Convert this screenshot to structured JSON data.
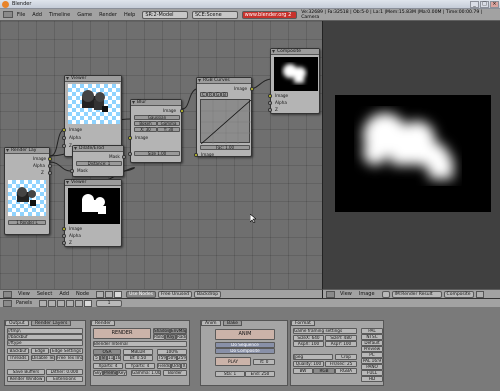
{
  "window": {
    "title": "Blender",
    "controls": [
      "_",
      "□",
      "×"
    ]
  },
  "info_header": {
    "menus": [
      "File",
      "Add",
      "Timeline",
      "Game",
      "Render",
      "Help"
    ],
    "screen": "SR:2-Model",
    "scene": "SCE:Scene",
    "url": "www.blender.org 2",
    "stats": "Ve:32689 | Fa:32518 | Ob:5-0 | La:1   |Mem:15.83M   |Ma:0.00M | Time:00:00.79 | Camera"
  },
  "nodes": {
    "viewer1": {
      "title": "Viewer",
      "inputs": [
        "Image",
        "Alpha",
        "Z"
      ]
    },
    "render_layers": {
      "title": "Render Lay",
      "outputs": [
        "Image",
        "Alpha",
        "Z"
      ],
      "layer": "1 Render L"
    },
    "blur": {
      "title": "Blur",
      "output": "Image",
      "type": "Gaussian",
      "bokeh": "Bokeh",
      "gamma": "Gamma",
      "x": "X: 30",
      "y": "Y: 30",
      "input": "Image",
      "size": "Size 1.00"
    },
    "dilate": {
      "title": "Dilate/Erod",
      "output": "Mask",
      "distance": "Distance: 1",
      "input": "Mask"
    },
    "viewer2": {
      "title": "Viewer",
      "inputs": [
        "Image",
        "Alpha",
        "Z"
      ]
    },
    "rgb_curves": {
      "title": "RGB Curves",
      "output": "Image",
      "channels": [
        "C",
        "R",
        "G",
        "B"
      ],
      "fac": "Fac: 1.00",
      "input": "Image"
    },
    "composite": {
      "title": "Composite",
      "inputs": [
        "Image",
        "Alpha",
        "Z"
      ]
    }
  },
  "node_header": {
    "menus": [
      "View",
      "Select",
      "Add",
      "Node"
    ],
    "buttons": [
      "Use Nodes",
      "Free Unused",
      "Backdrop"
    ]
  },
  "image_header": {
    "menus": [
      "View",
      "Image"
    ],
    "image_name": "IM:Render Result",
    "composite": "Composite"
  },
  "buttons_header": {
    "label": "Panels",
    "frame": "1"
  },
  "panels": {
    "output": {
      "tabs": [
        "Output",
        "Render Layers"
      ],
      "paths": [
        "//tmp\\",
        "//backbuf",
        "//ftype"
      ],
      "rows": [
        "Backbuf",
        "Edge",
        "Edge Settings",
        "Threads",
        "Disable Tex",
        "Free Tex Images",
        "Save Buffers",
        "Dither: 0.000",
        "Render Window",
        "Extensions"
      ]
    },
    "render": {
      "tab": "Render",
      "render_button": "RENDER",
      "shadow": "Shadow",
      "envmap": "EnvMap",
      "pano": "Pano",
      "ray": "Ray",
      "radio": "Radio",
      "engine": "Blender Internal",
      "osa": "OSA",
      "mblur": "MBLUR",
      "osa_levels": [
        "5",
        "8",
        "11",
        "16"
      ],
      "bf": "Bf: 0.50",
      "percent": [
        "100%",
        "75%",
        "50%",
        "25%"
      ],
      "xparts": "Xparts: 4",
      "yparts": "Yparts: 4",
      "fields": "Fields",
      "odd": "Odd",
      "x": "X",
      "sky": "Sky",
      "premul": "Premul",
      "key": "Key",
      "gamma": "Gamma: 1.00",
      "border": "Border"
    },
    "anim": {
      "tabs": [
        "Anim",
        "Bake"
      ],
      "anim_button": "ANIM",
      "do_sequence": "Do Sequence",
      "do_composite": "Do Composite",
      "play": "PLAY",
      "rt": "rt: 0",
      "sta": "Sta: 1",
      "end": "End: 250"
    },
    "format": {
      "tab": "Format",
      "preset": "Game framing settings",
      "sizex": "SizeX: 640",
      "sizey": "SizeY: 480",
      "aspx": "AspX: 100",
      "aspy": "AspY: 100",
      "format": "Jpeg",
      "crop": "Crop",
      "quality": "Quality: 100",
      "frs": "Frs/sec: 25",
      "bw": "BW",
      "rgb": "RGB",
      "rgba": "RGBA",
      "presets": [
        "PAL",
        "NTSC",
        "Default",
        "Preview",
        "PC",
        "PAL 16:9",
        "PANO",
        "FULL",
        "HD"
      ]
    }
  },
  "colors": {
    "node_bg": "#6f6f6f",
    "panel": "#a5a5a5",
    "socket_yellow": "#c8c829",
    "socket_blue": "#6464c8",
    "url_red": "#c8322c"
  }
}
